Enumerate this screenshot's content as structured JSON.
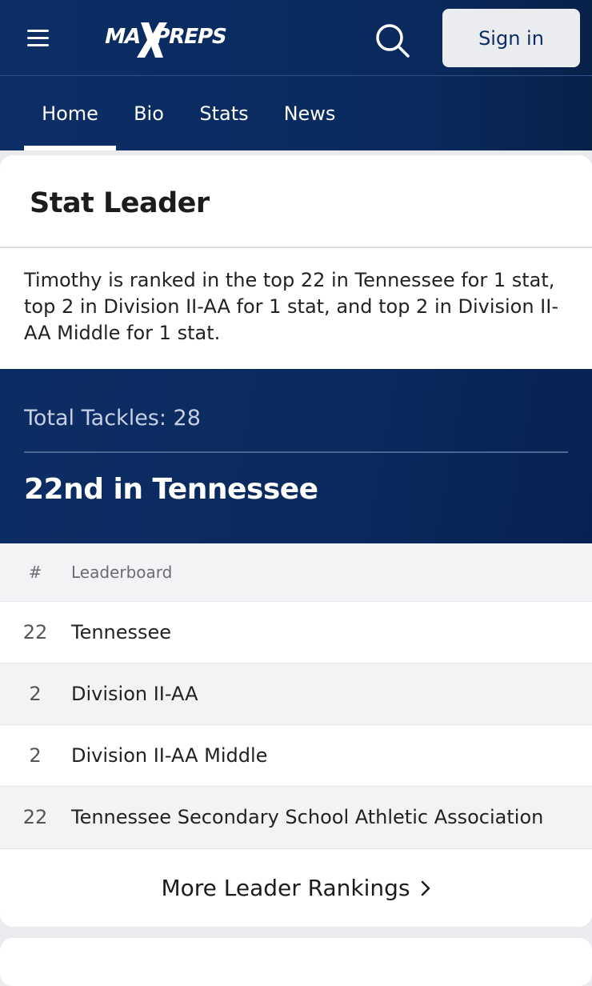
{
  "header": {
    "logo_text": "MAXPREPS",
    "signin_label": "Sign in",
    "icons": {
      "menu": "hamburger-menu-icon",
      "search": "search-icon"
    }
  },
  "tabs": [
    {
      "label": "Home",
      "active": true
    },
    {
      "label": "Bio",
      "active": false
    },
    {
      "label": "Stats",
      "active": false
    },
    {
      "label": "News",
      "active": false
    }
  ],
  "stat_leader": {
    "title": "Stat Leader",
    "summary": "Timothy is ranked in the top 22 in Tennessee for 1 stat, top 2 in Division II-AA for 1 stat, and top 2 in Division II-AA Middle for 1 stat.",
    "stat_label": "Total Tackles: 28",
    "rank_headline": "22nd in Tennessee",
    "table": {
      "headers": [
        "#",
        "Leaderboard"
      ],
      "rows": [
        {
          "rank": "22",
          "board": "Tennessee"
        },
        {
          "rank": "2",
          "board": "Division II-AA"
        },
        {
          "rank": "2",
          "board": "Division II-AA Middle"
        },
        {
          "rank": "22",
          "board": "Tennessee Secondary School Athletic Association"
        }
      ]
    },
    "more_label": "More Leader Rankings"
  },
  "colors": {
    "header_bg": "#0b2b60",
    "accent_text": "#0c2c63",
    "banner_bg": "#0b2a5f",
    "alt_row": "#f2f3f5"
  }
}
